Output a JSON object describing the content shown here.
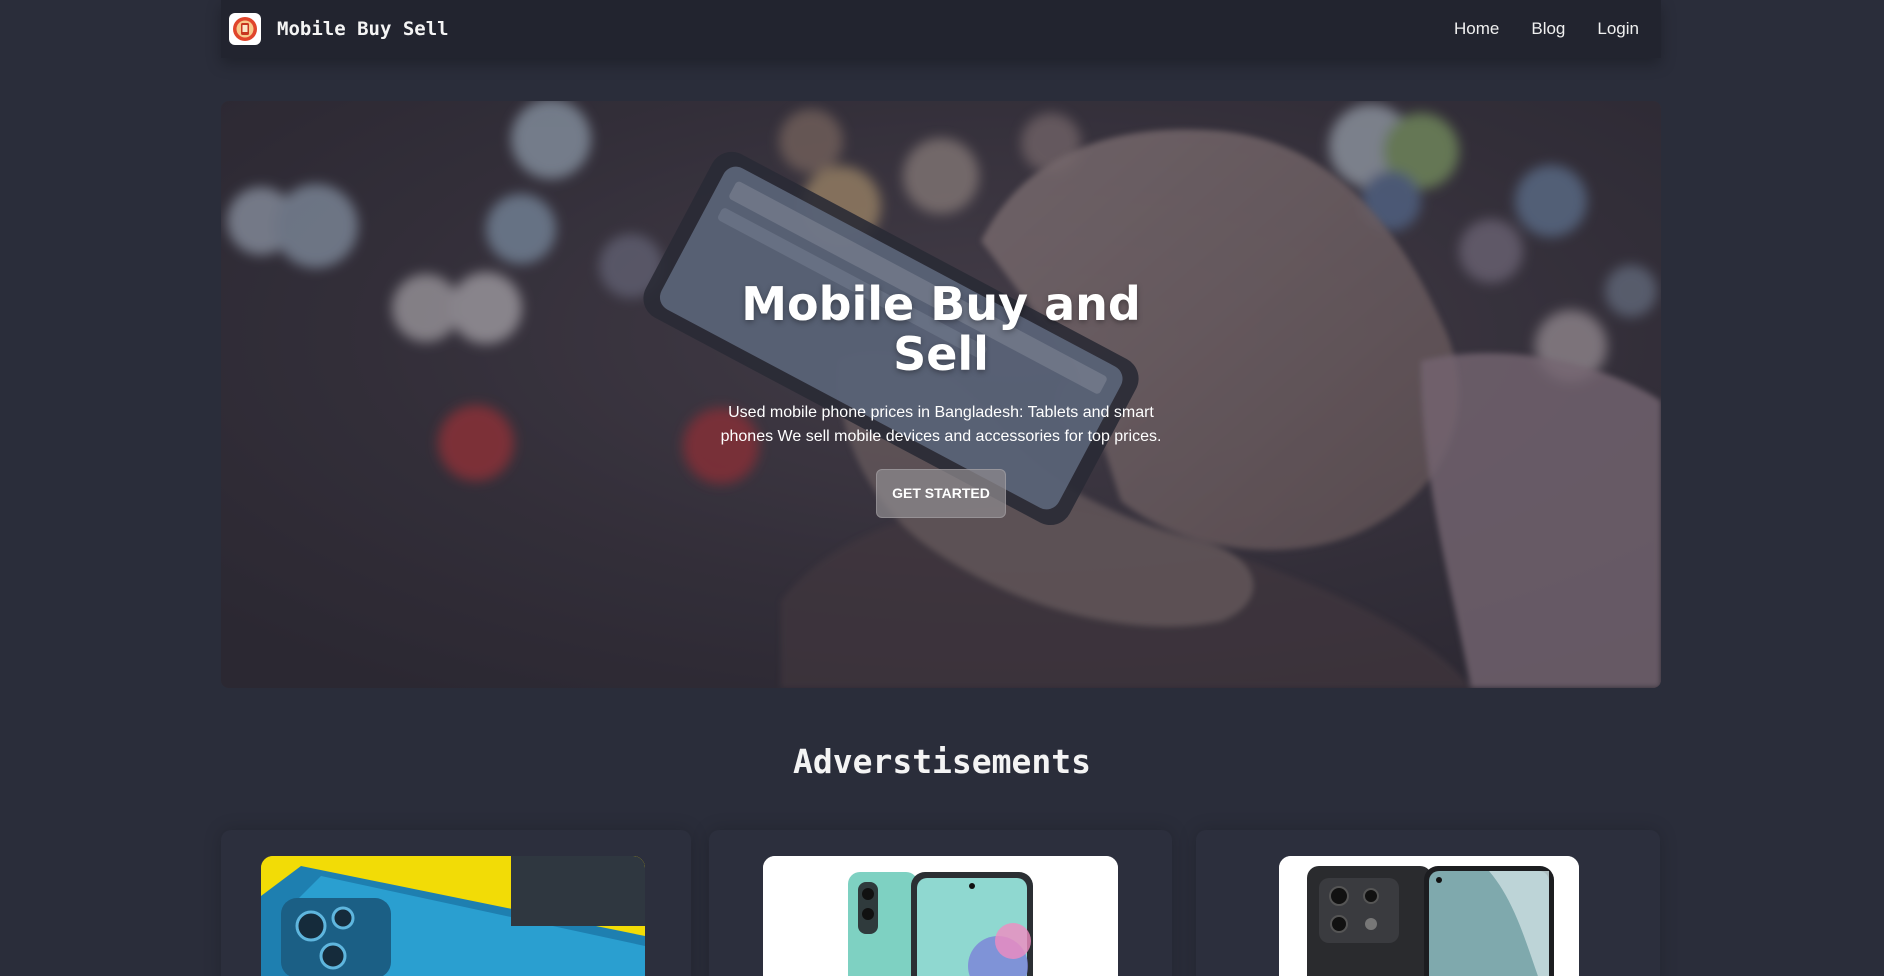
{
  "navbar": {
    "brand_name": "Mobile Buy Sell",
    "logo_icon": "shop-logo-icon",
    "links": [
      "Home",
      "Blog",
      "Login"
    ]
  },
  "hero": {
    "title": "Mobile Buy and Sell",
    "description": "Used mobile phone prices in Bangladesh: Tablets and smart phones We sell mobile devices and accessories for top prices.",
    "button_label": "GET STARTED",
    "background_icon": "hand-holding-phone-photo"
  },
  "ads": {
    "title": "Adverstisements",
    "cards": [
      {
        "image": "blue-phone-photo"
      },
      {
        "image": "mint-phone-photo"
      },
      {
        "image": "black-phone-photo"
      }
    ]
  },
  "colors": {
    "page_bg": "#2a2d3a",
    "navbar_bg": "#22242f",
    "text": "#f2f2f2"
  }
}
